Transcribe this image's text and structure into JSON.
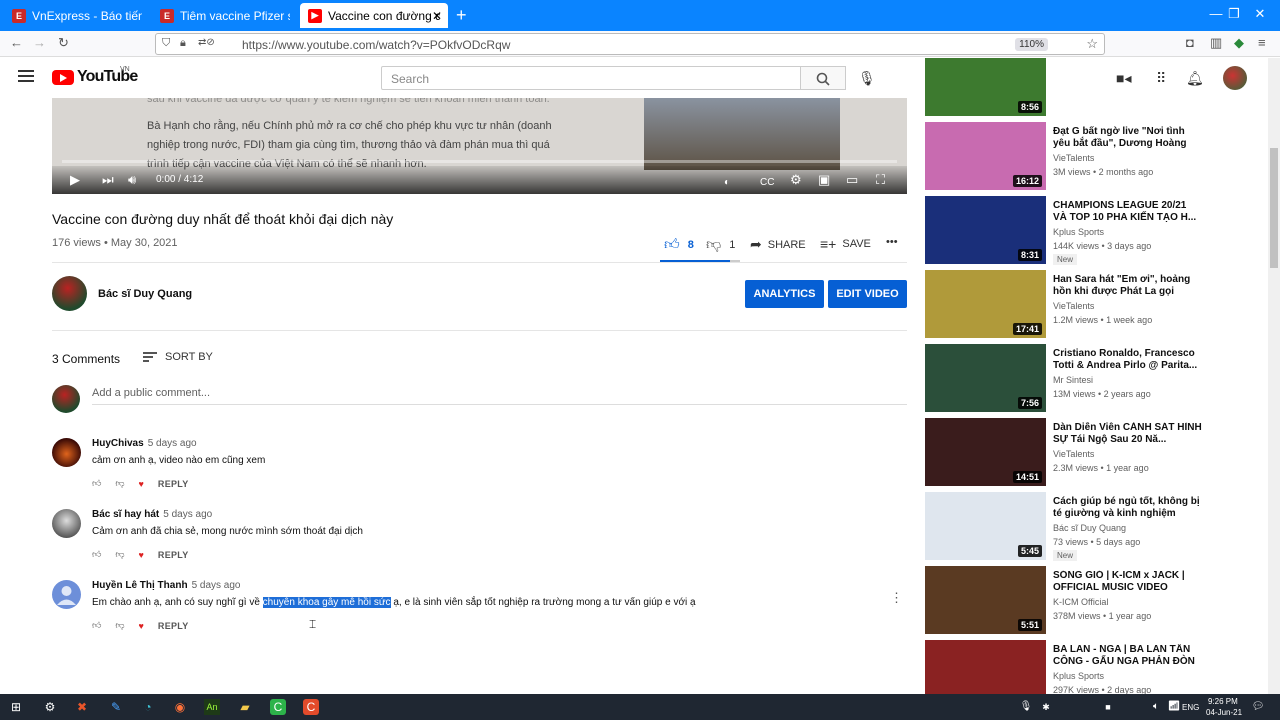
{
  "browser": {
    "tabs": [
      {
        "label": "VnExpress - Báo tiếng Việt",
        "fav_color": "#c92a2a",
        "active": false
      },
      {
        "label": "Tiêm vaccine Pfizer sau h",
        "fav_color": "#c92a2a",
        "active": false
      },
      {
        "label": "Vaccine con đường duy n",
        "fav_color": "#ff0000",
        "active": true
      }
    ],
    "url": "https://www.youtube.com/watch?v=POkfvODcRqw",
    "zoom": "110%"
  },
  "youtube": {
    "logo_text": "YouTube",
    "country": "VN",
    "search_placeholder": "Search"
  },
  "player": {
    "slide_lines": [
      "sau khi vaccine đã được cơ quan y tế kiểm nghiệm sẽ tiến khoản miễn thành toàn.",
      "Bà Hạnh cho rằng, nếu Chính phủ mở ra cơ chế cho phép khu vực tư nhân (doanh",
      "nghiệp trong nước, FDI) tham gia cùng tìm, thương thảo và đàm phán mua thì quá",
      "trình tiếp cận vaccine của Việt Nam có thể sẽ nhanh hơn."
    ],
    "time": "0:00 / 4:12"
  },
  "video": {
    "title": "Vaccine con đường duy nhất để thoát khỏi đại dịch này",
    "meta": "176 views • May 30, 2021",
    "likes": "8",
    "dislikes": "1",
    "share_label": "SHARE",
    "save_label": "SAVE",
    "more_label": "•••"
  },
  "channel": {
    "name": "Bác sĩ Duy Quang",
    "analytics_label": "ANALYTICS",
    "edit_label": "EDIT VIDEO"
  },
  "comments": {
    "count_label": "3 Comments",
    "sort_label": "SORT BY",
    "add_placeholder": "Add a public comment...",
    "reply_label": "REPLY",
    "items": [
      {
        "author": "HuyChivas",
        "date": "5 days ago",
        "text": "cảm ơn anh ạ, video nào em cũng xem",
        "avatar_color": "#7a1a0e"
      },
      {
        "author": "Bác sĩ hay hát",
        "date": "5 days ago",
        "text": "Cảm ơn anh đã chia sẻ, mong nước mình sớm thoát đại dịch",
        "avatar_color": "#8a8a8a"
      },
      {
        "author": "Huyền Lê Thị Thanh",
        "date": "5 days ago",
        "text_before": "Em chào anh ạ, anh có suy nghĩ gì về ",
        "text_highlight": "chuyên khoa gây mê hồi sức",
        "text_after": " ạ, e là sinh viên sắp tốt nghiệp ra trường mong a tư vấn giúp e với ạ",
        "avatar_color": "#6d8fd9"
      }
    ]
  },
  "sidebar": [
    {
      "title": "",
      "channel": "",
      "meta": "",
      "duration": "8:56",
      "thumb": "#3d7a2f",
      "new": false
    },
    {
      "title": "Đạt G bất ngờ live \"Nơi tình yêu bắt đầu\", Dương Hoàng Yến...",
      "channel": "VieTalents",
      "meta": "3M views • 2 months ago",
      "duration": "16:12",
      "thumb": "#c86bb0",
      "new": false
    },
    {
      "title": "CHAMPIONS LEAGUE 20/21 VÀ TOP 10 PHA KIẾN TẠO H...",
      "channel": "Kplus Sports",
      "meta": "144K views • 3 days ago",
      "duration": "8:31",
      "thumb": "#1a2f7a",
      "new": true
    },
    {
      "title": "Han Sara hát \"Em ơi\", hoảng hồn khi được Phát La gọi \"Vợ...",
      "channel": "VieTalents",
      "meta": "1.2M views • 1 week ago",
      "duration": "17:41",
      "thumb": "#b09a3a",
      "new": false
    },
    {
      "title": "Cristiano Ronaldo, Francesco Totti & Andrea Pirlo @ Parita...",
      "channel": "Mr Sintesi",
      "meta": "13M views • 2 years ago",
      "duration": "7:56",
      "thumb": "#2b4f3a",
      "new": false
    },
    {
      "title": "Dàn Diễn Viên CẢNH SÁT HÌNH SỰ Tái Ngộ Sau 20 Nă...",
      "channel": "VieTalents",
      "meta": "2.3M views • 1 year ago",
      "duration": "14:51",
      "thumb": "#3a1c1c",
      "new": false
    },
    {
      "title": "Cách giúp bé ngủ tốt, không bị té giường và kinh nghiệm chọ...",
      "channel": "Bác sĩ Duy Quang",
      "meta": "73 views • 5 days ago",
      "duration": "5:45",
      "thumb": "#dfe6ee",
      "new": true
    },
    {
      "title": "SÓNG GIÓ | K-ICM x JACK | OFFICIAL MUSIC VIDEO",
      "channel": "K-ICM Official",
      "meta": "378M views • 1 year ago",
      "duration": "5:51",
      "thumb": "#5a3a22",
      "new": false
    },
    {
      "title": "BA LAN - NGA | BA LAN TẤN CÔNG - GẤU NGA PHẢN ĐÒN",
      "channel": "Kplus Sports",
      "meta": "297K views • 2 days ago",
      "duration": "",
      "thumb": "#8a2222",
      "new": false
    }
  ],
  "new_badge": "New",
  "taskbar": {
    "time": "9:26 PM",
    "date": "04-Jun-21",
    "lang": "ENG"
  }
}
